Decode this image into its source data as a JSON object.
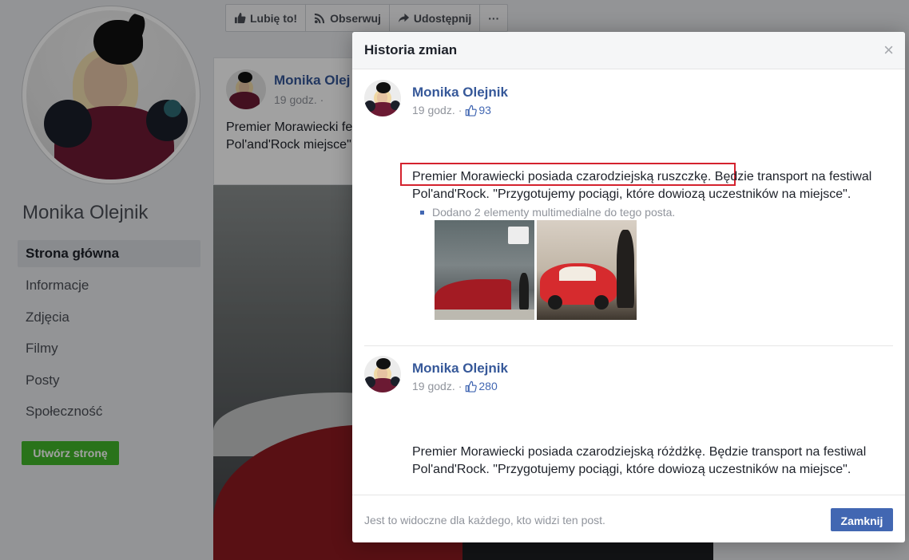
{
  "page": {
    "name": "Monika Olejnik",
    "nav": [
      {
        "label": "Strona główna",
        "active": true
      },
      {
        "label": "Informacje"
      },
      {
        "label": "Zdjęcia"
      },
      {
        "label": "Filmy"
      },
      {
        "label": "Posty"
      },
      {
        "label": "Społeczność"
      }
    ],
    "create_page_label": "Utwórz stronę",
    "actions": {
      "like": "Lubię to!",
      "follow": "Obserwuj",
      "share": "Udostępnij",
      "more": "···"
    },
    "post": {
      "author": "Monika Olej",
      "time": "19 godz. ·",
      "text": "Premier Morawiecki festiwal Pol'and'Rock miejsce\"."
    }
  },
  "modal": {
    "title": "Historia zmian",
    "close_icon": "×",
    "revisions": [
      {
        "author": "Monika Olejnik",
        "time": "19 godz.",
        "likes": "93",
        "text": "Premier Morawiecki posiada czarodziejską ruszczkę. Będzie transport na festiwal Pol'and'Rock. \"Przygotujemy pociągi, które dowiozą uczestników na miejsce\".",
        "media_note": "Dodano 2 elementy multimedialne do tego posta."
      },
      {
        "author": "Monika Olejnik",
        "time": "19 godz.",
        "likes": "280",
        "text": "Premier Morawiecki posiada czarodziejską różdżkę. Będzie transport na festiwal Pol'and'Rock. \"Przygotujemy pociągi, które dowiozą uczestników na miejsce\"."
      }
    ],
    "footer_note": "Jest to widoczne dla każdego, kto widzi ten post.",
    "close_button": "Zamknij"
  },
  "colors": {
    "link": "#365899",
    "primary_button": "#4267b2",
    "create_button": "#42b72a",
    "highlight": "#d4222e"
  }
}
